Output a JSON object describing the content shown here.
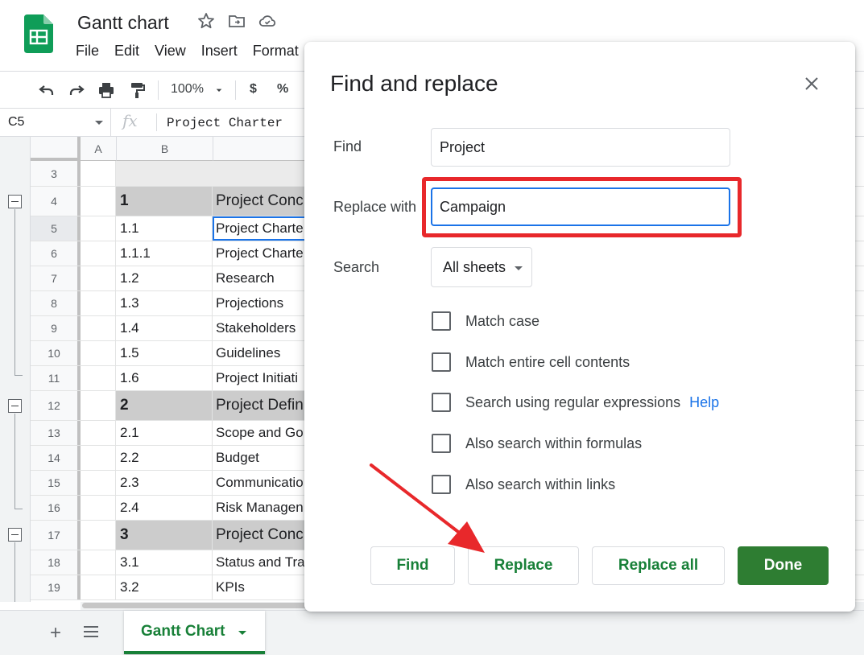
{
  "app": {
    "doc_title": "Gantt chart",
    "menu": [
      "File",
      "Edit",
      "View",
      "Insert",
      "Format"
    ]
  },
  "toolbar": {
    "zoom": "100%",
    "currency": "$",
    "percent": "%"
  },
  "formula_bar": {
    "cell_ref": "C5",
    "fx": "fx",
    "content": "Project Charter"
  },
  "columns": [
    "A",
    "B"
  ],
  "rows": [
    {
      "num": "3",
      "b": "",
      "c": "",
      "kind": "blank"
    },
    {
      "num": "4",
      "b": "1",
      "c": "Project Conc",
      "kind": "section"
    },
    {
      "num": "5",
      "b": "1.1",
      "c": "Project Charte",
      "kind": "item"
    },
    {
      "num": "6",
      "b": "1.1.1",
      "c": "Project Charte",
      "kind": "item"
    },
    {
      "num": "7",
      "b": "1.2",
      "c": "Research",
      "kind": "item"
    },
    {
      "num": "8",
      "b": "1.3",
      "c": "Projections",
      "kind": "item"
    },
    {
      "num": "9",
      "b": "1.4",
      "c": "Stakeholders",
      "kind": "item"
    },
    {
      "num": "10",
      "b": "1.5",
      "c": "Guidelines",
      "kind": "item"
    },
    {
      "num": "11",
      "b": "1.6",
      "c": "Project Initiati",
      "kind": "item"
    },
    {
      "num": "12",
      "b": "2",
      "c": "Project Defin",
      "kind": "section"
    },
    {
      "num": "13",
      "b": "2.1",
      "c": "Scope and Go",
      "kind": "item"
    },
    {
      "num": "14",
      "b": "2.2",
      "c": "Budget",
      "kind": "item"
    },
    {
      "num": "15",
      "b": "2.3",
      "c": "Communicatio",
      "kind": "item"
    },
    {
      "num": "16",
      "b": "2.4",
      "c": "Risk Managen",
      "kind": "item"
    },
    {
      "num": "17",
      "b": "3",
      "c": "Project Conc",
      "kind": "section"
    },
    {
      "num": "18",
      "b": "3.1",
      "c": "Status and Tra",
      "kind": "item"
    },
    {
      "num": "19",
      "b": "3.2",
      "c": "KPIs",
      "kind": "item"
    }
  ],
  "sheet_tab": {
    "label": "Gantt Chart"
  },
  "dialog": {
    "title": "Find and replace",
    "find_label": "Find",
    "find_value": "Project",
    "replace_label": "Replace with",
    "replace_value": "Campaign",
    "search_label": "Search",
    "search_value": "All sheets",
    "options": [
      {
        "label": "Match case",
        "checked": false
      },
      {
        "label": "Match entire cell contents",
        "checked": false
      },
      {
        "label": "Search using regular expressions",
        "checked": false,
        "link": "Help"
      },
      {
        "label": "Also search within formulas",
        "checked": false
      },
      {
        "label": "Also search within links",
        "checked": false
      }
    ],
    "buttons": {
      "find": "Find",
      "replace": "Replace",
      "replace_all": "Replace all",
      "done": "Done"
    }
  },
  "colors": {
    "brand_green": "#188038",
    "done_green": "#2e7d32",
    "annotation_red": "#e8282b",
    "focus_blue": "#1a73e8"
  }
}
